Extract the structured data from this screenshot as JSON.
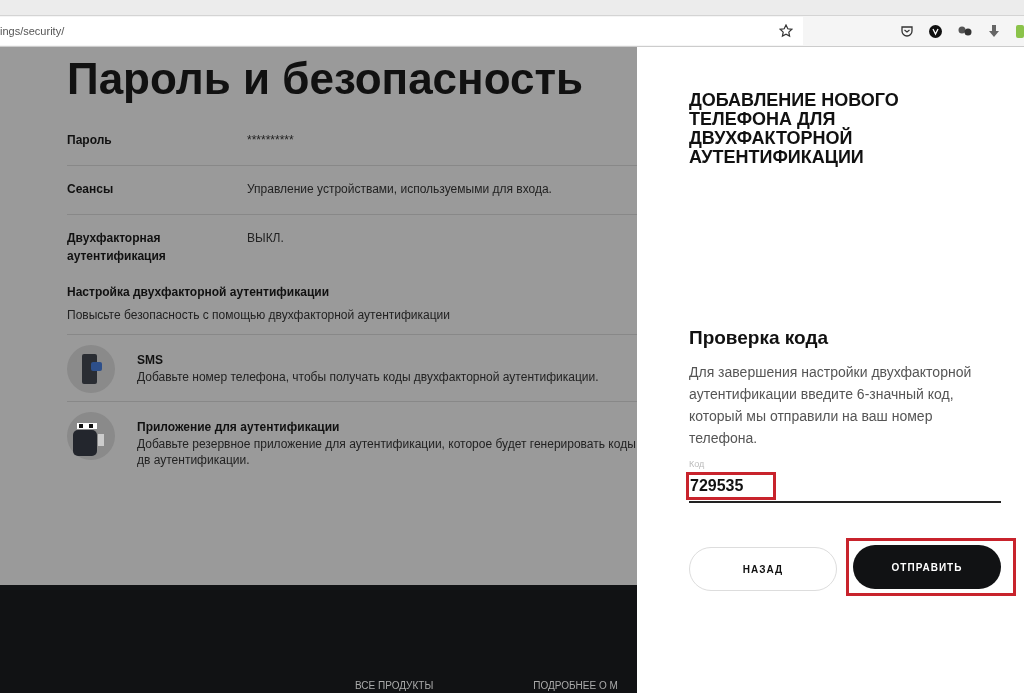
{
  "browser": {
    "url": "ings/security/"
  },
  "page": {
    "title": "Пароль и безопасность",
    "rows": [
      {
        "label": "Пароль",
        "value": "**********"
      },
      {
        "label": "Сеансы",
        "value": "Управление устройствами, используемыми для входа."
      },
      {
        "label": "Двухфакторная аутентификация",
        "value": "ВЫКЛ."
      }
    ],
    "setup": {
      "heading": "Настройка двухфакторной аутентификации",
      "text": "Повысьте безопасность с помощью двухфакторной аутентификации",
      "methods": [
        {
          "kind": "sms",
          "title": "SMS",
          "text": "Добавьте номер телефона, чтобы получать коды двухфакторной аутентификации."
        },
        {
          "kind": "app",
          "title": "Приложение для аутентификации",
          "text": "Добавьте резервное приложение для аутентификации, которое будет генерировать коды дв аутентификации."
        }
      ]
    },
    "footer": {
      "links": [
        "ВСЕ ПРОДУКТЫ",
        "ПОДРОБНЕЕ О М"
      ]
    }
  },
  "dialog": {
    "title": "ДОБАВЛЕНИЕ НОВОГО ТЕЛЕФОНА ДЛЯ ДВУХФАКТОРНОЙ АУТЕНТИФИКАЦИИ",
    "heading": "Проверка кода",
    "text": "Для завершения настройки двухфакторной аутентификации введите 6-значный код, который мы отправили на ваш номер телефона.",
    "field": {
      "label": "Код",
      "value": "729535",
      "highlighted": true
    },
    "buttons": [
      {
        "label": "НАЗАД",
        "kind": "secondary",
        "highlighted": false
      },
      {
        "label": "ОТПРАВИТЬ",
        "kind": "primary",
        "highlighted": true
      }
    ]
  }
}
